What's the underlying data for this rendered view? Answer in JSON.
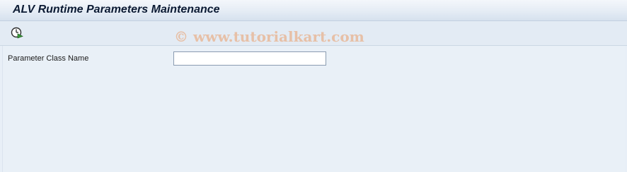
{
  "window": {
    "title": "ALV Runtime Parameters Maintenance"
  },
  "toolbar": {
    "execute_icon": "execute-clock-icon"
  },
  "watermark": {
    "text": "© www.tutorialkart.com"
  },
  "form": {
    "parameter_class": {
      "label": "Parameter Class Name",
      "value": "",
      "placeholder": ""
    }
  },
  "colors": {
    "background": "#e8eff7",
    "title_text": "#0b1a33",
    "watermark": "#eb965a",
    "icon_green": "#2e7d32"
  }
}
